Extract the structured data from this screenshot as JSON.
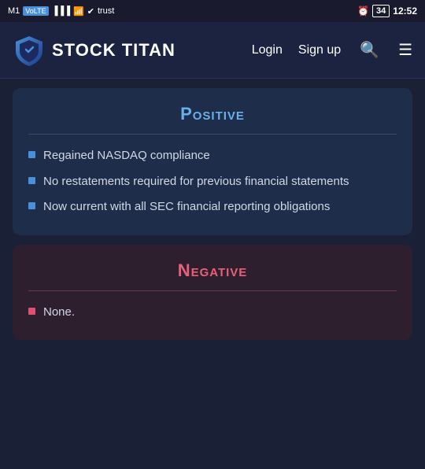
{
  "statusBar": {
    "carrier": "M1",
    "volte": "VoLTE",
    "signal": "signal",
    "wifi": "wifi",
    "whatsapp": "whatsapp",
    "trust": "trust",
    "alarm": "alarm",
    "battery": "34",
    "time": "12:52"
  },
  "navbar": {
    "logoText": "STOCK TITAN",
    "loginLabel": "Login",
    "signupLabel": "Sign up"
  },
  "positiveCard": {
    "title": "Positive",
    "items": [
      "Regained NASDAQ compliance",
      "No restatements required for previous financial statements",
      "Now current with all SEC financial reporting obligations"
    ]
  },
  "negativeCard": {
    "title": "Negative",
    "items": [
      "None."
    ]
  }
}
